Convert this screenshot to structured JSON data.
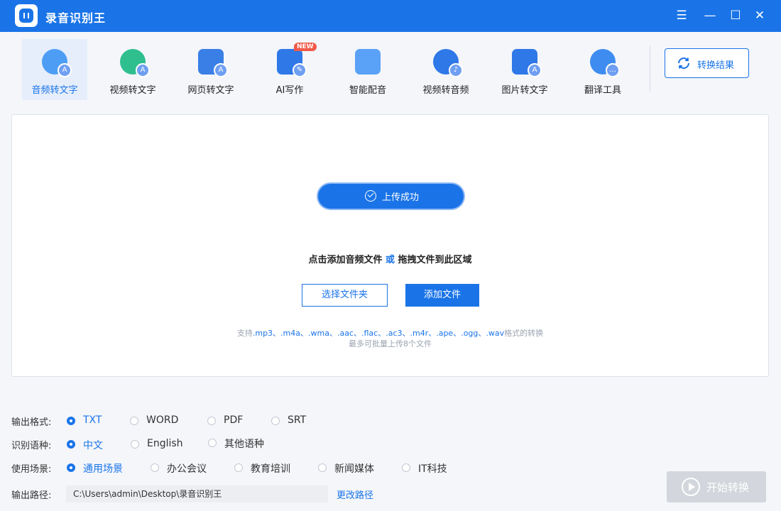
{
  "app": {
    "title": "录音识别王"
  },
  "toolbar": {
    "tools": [
      {
        "label": "音频转文字",
        "icon": "audio-to-text-icon",
        "active": true
      },
      {
        "label": "视频转文字",
        "icon": "video-to-text-icon",
        "active": false
      },
      {
        "label": "网页转文字",
        "icon": "webpage-to-text-icon",
        "active": false
      },
      {
        "label": "AI写作",
        "icon": "ai-writing-icon",
        "active": false,
        "badge": "NEW"
      },
      {
        "label": "智能配音",
        "icon": "smart-dubbing-icon",
        "active": false
      },
      {
        "label": "视频转音频",
        "icon": "video-to-audio-icon",
        "active": false
      },
      {
        "label": "图片转文字",
        "icon": "image-to-text-icon",
        "active": false
      },
      {
        "label": "翻译工具",
        "icon": "translate-tool-icon",
        "active": false
      }
    ],
    "result_button": "转换结果"
  },
  "dropzone": {
    "upload_status": "上传成功",
    "hint_part1": "点击添加音频文件",
    "hint_or": "或",
    "hint_part2": "拖拽文件到此区域",
    "choose_folder": "选择文件夹",
    "add_file": "添加文件",
    "support_prefix": "支持",
    "support_exts": ".mp3、.m4a、.wma、.aac、.flac、.ac3、.m4r、.ape、.ogg、.wav",
    "support_suffix": "格式的转换",
    "limit": "最多可批量上传8个文件"
  },
  "options": {
    "format": {
      "label": "输出格式:",
      "choices": [
        "TXT",
        "WORD",
        "PDF",
        "SRT"
      ],
      "selected": "TXT"
    },
    "language": {
      "label": "识别语种:",
      "choices": [
        "中文",
        "English",
        "其他语种"
      ],
      "selected": "中文"
    },
    "scene": {
      "label": "使用场景:",
      "choices": [
        "通用场景",
        "办公会议",
        "教育培训",
        "新闻媒体",
        "IT科技"
      ],
      "selected": "通用场景"
    },
    "path": {
      "label": "输出路径:",
      "value": "C:\\Users\\admin\\Desktop\\录音识别王",
      "change": "更改路径"
    }
  },
  "start_button": "开始转换",
  "colors": {
    "accent": "#1a74e8",
    "badge": "#f05a48",
    "disabled": "#d3d6dc"
  }
}
